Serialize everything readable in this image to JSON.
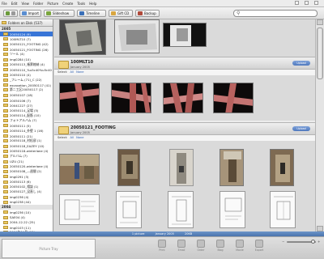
{
  "menubar": {
    "items": [
      "File",
      "Edit",
      "View",
      "Folder",
      "Picture",
      "Create",
      "Tools",
      "Help"
    ]
  },
  "toolbar": {
    "buttons": [
      {
        "label": "Import",
        "icon": "import-icon",
        "color": "#5a8ed1"
      },
      {
        "label": "Slideshow",
        "icon": "slideshow-icon",
        "color": "#7aa63d"
      },
      {
        "label": "Timeline",
        "icon": "timeline-icon",
        "color": "#3a6fb8"
      },
      {
        "label": "Gift CD",
        "icon": "gift-cd-icon",
        "color": "#d9a640"
      },
      {
        "label": "Backup",
        "icon": "backup-icon",
        "color": "#b04a3b"
      }
    ],
    "search": {
      "value": "",
      "placeholder": ""
    }
  },
  "sidebar": {
    "header": "Folders on Disk (537)",
    "sections": [
      {
        "title": "2005",
        "folders": [
          {
            "label": "20050124 (9)",
            "selected": true
          },
          {
            "label": "100MLT10 (7)"
          },
          {
            "label": "20050121_FOOTING (42)"
          },
          {
            "label": "20050121_FOOTING (26)"
          },
          {
            "label": "ツール (4)"
          },
          {
            "label": "img0284 (10)"
          },
          {
            "label": "20050113_帳票格納 (4)"
          },
          {
            "label": "20050110_%u5c40%u5c40 (4)"
          },
          {
            "label": "20050110 (4)"
          },
          {
            "label": "_フレーム (71)_C (22)"
          },
          {
            "label": "excavation_20050117 (41)"
          },
          {
            "label": "第二工区20050117 (2)"
          },
          {
            "label": "20050107 (18)"
          },
          {
            "label": "20050106 (7)"
          },
          {
            "label": "20041227 (27)"
          },
          {
            "label": "20050114_足場 (5)"
          },
          {
            "label": "20050114_配筋 (10)"
          },
          {
            "label": "フォトアルバム (7)"
          },
          {
            "label": "20050111 (5)"
          },
          {
            "label": "20050114_外壁 1 (16)"
          },
          {
            "label": "20050111 (21)"
          },
          {
            "label": "20050118_村松邸 (1)"
          },
          {
            "label": "20050118_EAZEY (10)"
          },
          {
            "label": "20050118-winterlane (4)"
          },
          {
            "label": "アルバム (7)"
          },
          {
            "label": "UZU (21)"
          },
          {
            "label": "20050120-winterlane (4)"
          },
          {
            "label": "20050108_—週間 (2)"
          },
          {
            "label": "img0291 (3)"
          },
          {
            "label": "20050113 (6)"
          },
          {
            "label": "20050102_相談 (1)"
          },
          {
            "label": "20050127_没直し (4)"
          },
          {
            "label": "img0236 (4)"
          },
          {
            "label": "img0238 (44)"
          }
        ]
      },
      {
        "title": "2004",
        "folders": [
          {
            "label": "img0236 (10)"
          },
          {
            "label": "SAE04 (4)"
          },
          {
            "label": "2004-12-22 (25)"
          },
          {
            "label": "img0103 (11)"
          },
          {
            "label": "2004年11月 (12)"
          }
        ]
      }
    ]
  },
  "groups": [
    {
      "title": "100MLT10",
      "date": "January 2005",
      "button": "Upload",
      "select": "Select:",
      "select_all": "All",
      "select_none": "None"
    },
    {
      "title": "20050121_FOOTING",
      "date": "January 2005",
      "button": "Upload",
      "select": "Select:",
      "select_all": "All",
      "select_none": "None"
    }
  ],
  "status": {
    "left": "1 picture",
    "mid": "January 2005",
    "right": "20KB"
  },
  "bottom": {
    "tray_label": "Picture Tray",
    "tools": [
      "Print",
      "Email",
      "Order",
      "Blog",
      "Movie",
      "Export"
    ]
  },
  "colors": {
    "selection": "#3875d7",
    "statusbar": "#5a84be",
    "folder": "#e9c862"
  }
}
